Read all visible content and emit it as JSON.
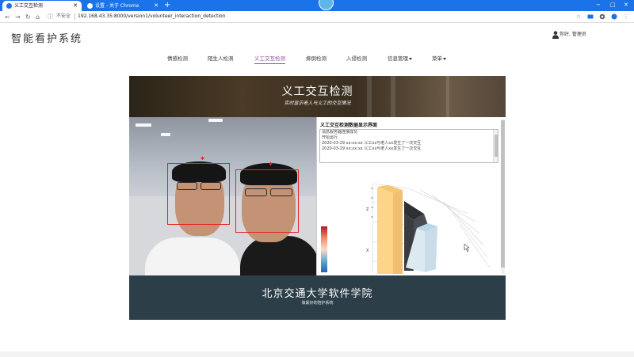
{
  "browser": {
    "tabs": [
      {
        "title": "义工交互检测",
        "active": true
      },
      {
        "title": "设置 - 关于 Chrome",
        "active": false
      }
    ],
    "new_tab_label": "+",
    "profile_text": "",
    "url_security": "不安全",
    "url": "192.168.43.35:8000/version1/volunteer_interaction_detection",
    "window_controls": [
      "−",
      "□",
      "✕"
    ]
  },
  "header": {
    "site_title": "智能看护系统",
    "user_text": "你好, 管理员"
  },
  "nav": {
    "items": [
      {
        "label": "情感检测"
      },
      {
        "label": "陌生人检测"
      },
      {
        "label": "义工交互检测"
      },
      {
        "label": "摔倒检测"
      },
      {
        "label": "入侵检测"
      },
      {
        "label": "信息管理"
      },
      {
        "label": "菜单"
      }
    ],
    "active": "义工交互检测"
  },
  "banner": {
    "title": "义工交互检测",
    "subtitle": "实时显示老人与义工的交互情况"
  },
  "panel": {
    "title": "义工交互检测数据显示界面",
    "log_lines": [
      "消息服务器连接成功",
      "开始运行",
      "2020-03-29 xx:xx:xx 义工xx与老人xx发生了一次交互",
      "2020-03-29 xx:xx:xx 义工xx与老人xx发生了一次交互"
    ],
    "axis_labels": {
      "z": "Z",
      "x": "X"
    }
  },
  "footer": {
    "title": "北京交通大学软件学院",
    "subtitle": "做最好的陪护系统"
  },
  "colors": {
    "chrome_blue": "#1a73e8",
    "nav_active": "#8a4fa1",
    "footer_bg": "#2c3e48",
    "face_box": "#e5261e"
  },
  "icons": {
    "back": "arrow-left-icon",
    "forward": "arrow-right-icon",
    "reload": "reload-icon",
    "home": "home-icon",
    "star": "star-icon",
    "user": "user-icon"
  }
}
